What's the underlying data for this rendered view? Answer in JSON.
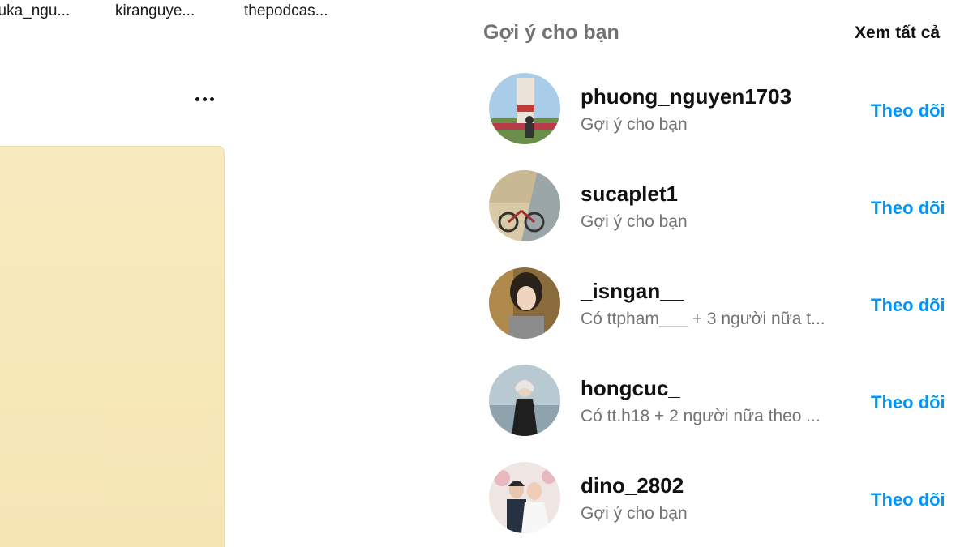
{
  "stories": [
    {
      "name": "suka_ngu..."
    },
    {
      "name": "kiranguye..."
    },
    {
      "name": "thepodcas..."
    }
  ],
  "post": {
    "more_icon": "more-horizontal-icon",
    "media_color": "#f7e8b9"
  },
  "suggestions": {
    "title": "Gợi ý cho bạn",
    "see_all": "Xem tất cả",
    "follow_color": "#0095f6",
    "items": [
      {
        "username": "phuong_nguyen1703",
        "subtext": "Gợi ý cho bạn",
        "action": "Theo dõi"
      },
      {
        "username": "sucaplet1",
        "subtext": "Gợi ý cho bạn",
        "action": "Theo dõi"
      },
      {
        "username": "_isngan__",
        "subtext": "Có ttpham___ + 3 người nữa t...",
        "action": "Theo dõi"
      },
      {
        "username": "hongcuc_",
        "subtext": "Có tt.h18 + 2 người nữa theo ...",
        "action": "Theo dõi"
      },
      {
        "username": "dino_2802",
        "subtext": "Gợi ý cho bạn",
        "action": "Theo dõi"
      }
    ]
  }
}
